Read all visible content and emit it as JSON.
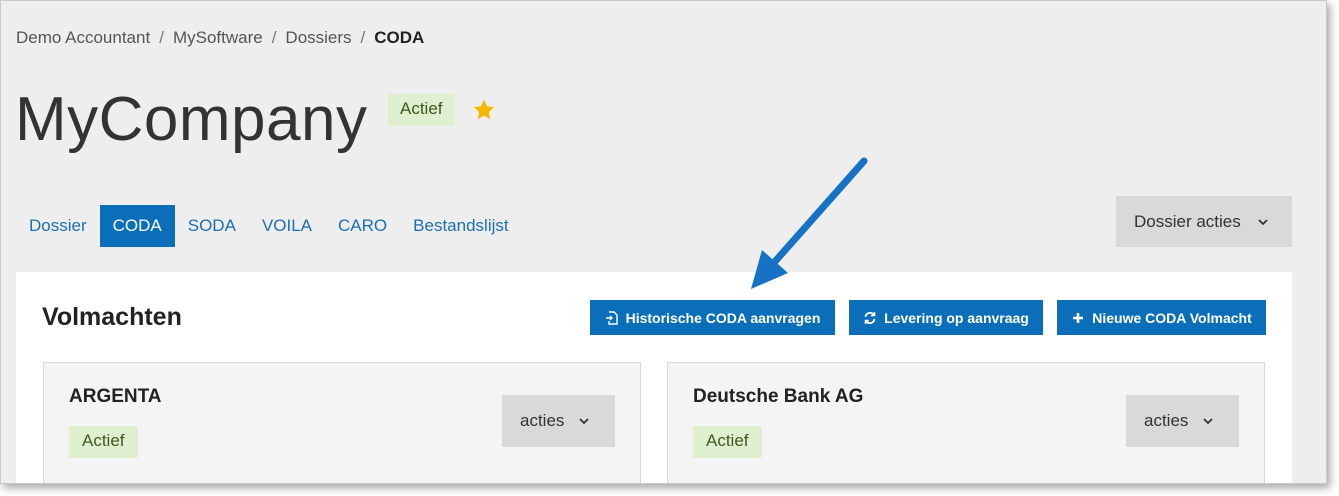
{
  "breadcrumb": {
    "items": [
      "Demo Accountant",
      "MySoftware",
      "Dossiers"
    ],
    "current": "CODA",
    "separator": "/"
  },
  "header": {
    "title": "MyCompany",
    "status": "Actief",
    "favorite_icon": "star-icon",
    "favorite_color": "#f5b800"
  },
  "tabs": [
    "Dossier",
    "CODA",
    "SODA",
    "VOILA",
    "CARO",
    "Bestandslijst"
  ],
  "active_tab": "CODA",
  "dossier_actions": {
    "label": "Dossier acties",
    "icon": "chevron-down-icon"
  },
  "panel": {
    "title": "Volmachten",
    "buttons": {
      "historical": {
        "label": "Historische CODA aanvragen",
        "icon": "document-import-icon"
      },
      "delivery": {
        "label": "Levering op aanvraag",
        "icon": "refresh-icon"
      },
      "new": {
        "label": "Nieuwe CODA Volmacht",
        "icon": "plus-icon"
      }
    },
    "cards": [
      {
        "bank": "ARGENTA",
        "status": "Actief",
        "actions_label": "acties"
      },
      {
        "bank": "Deutsche Bank AG",
        "status": "Actief",
        "actions_label": "acties"
      }
    ]
  },
  "colors": {
    "accent": "#0a6fb8",
    "link": "#1a6fb3",
    "status_bg": "#e0efcf",
    "status_text": "#3b5a1e",
    "annotation_arrow": "#1672c4"
  }
}
